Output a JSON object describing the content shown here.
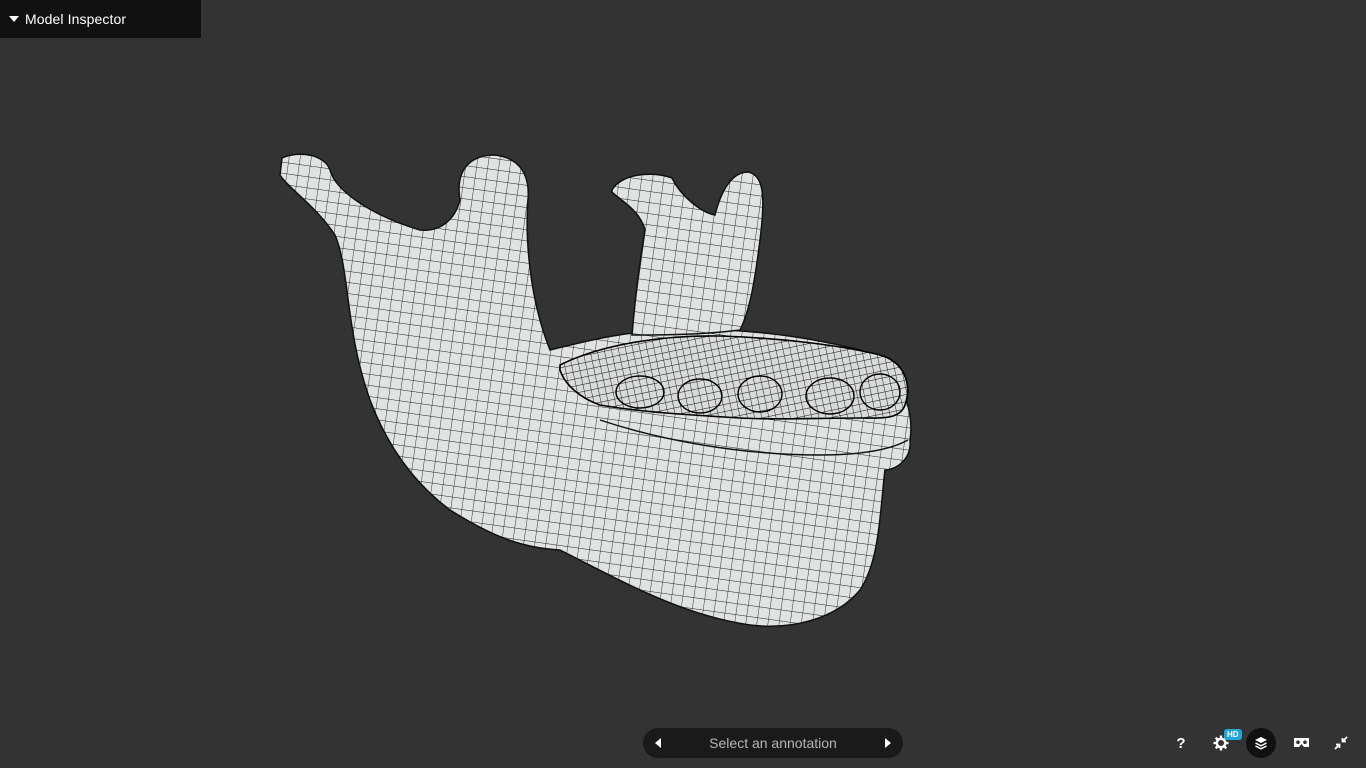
{
  "inspector": {
    "label": "Model Inspector",
    "icon": "caret-down-icon"
  },
  "annotation_bar": {
    "placeholder": "Select an annotation",
    "prev_icon": "arrow-left-icon",
    "next_icon": "arrow-right-icon"
  },
  "controls": {
    "help_label": "?",
    "settings_badge": "HD",
    "icons": [
      "help-icon",
      "settings-icon",
      "layers-icon",
      "vr-headset-icon",
      "fullscreen-exit-icon"
    ]
  },
  "colors": {
    "background": "#333333",
    "panel": "#111111",
    "mesh_fill": "#dfe3e2",
    "mesh_line": "#1a1a1a",
    "badge": "#1ea8d8"
  }
}
